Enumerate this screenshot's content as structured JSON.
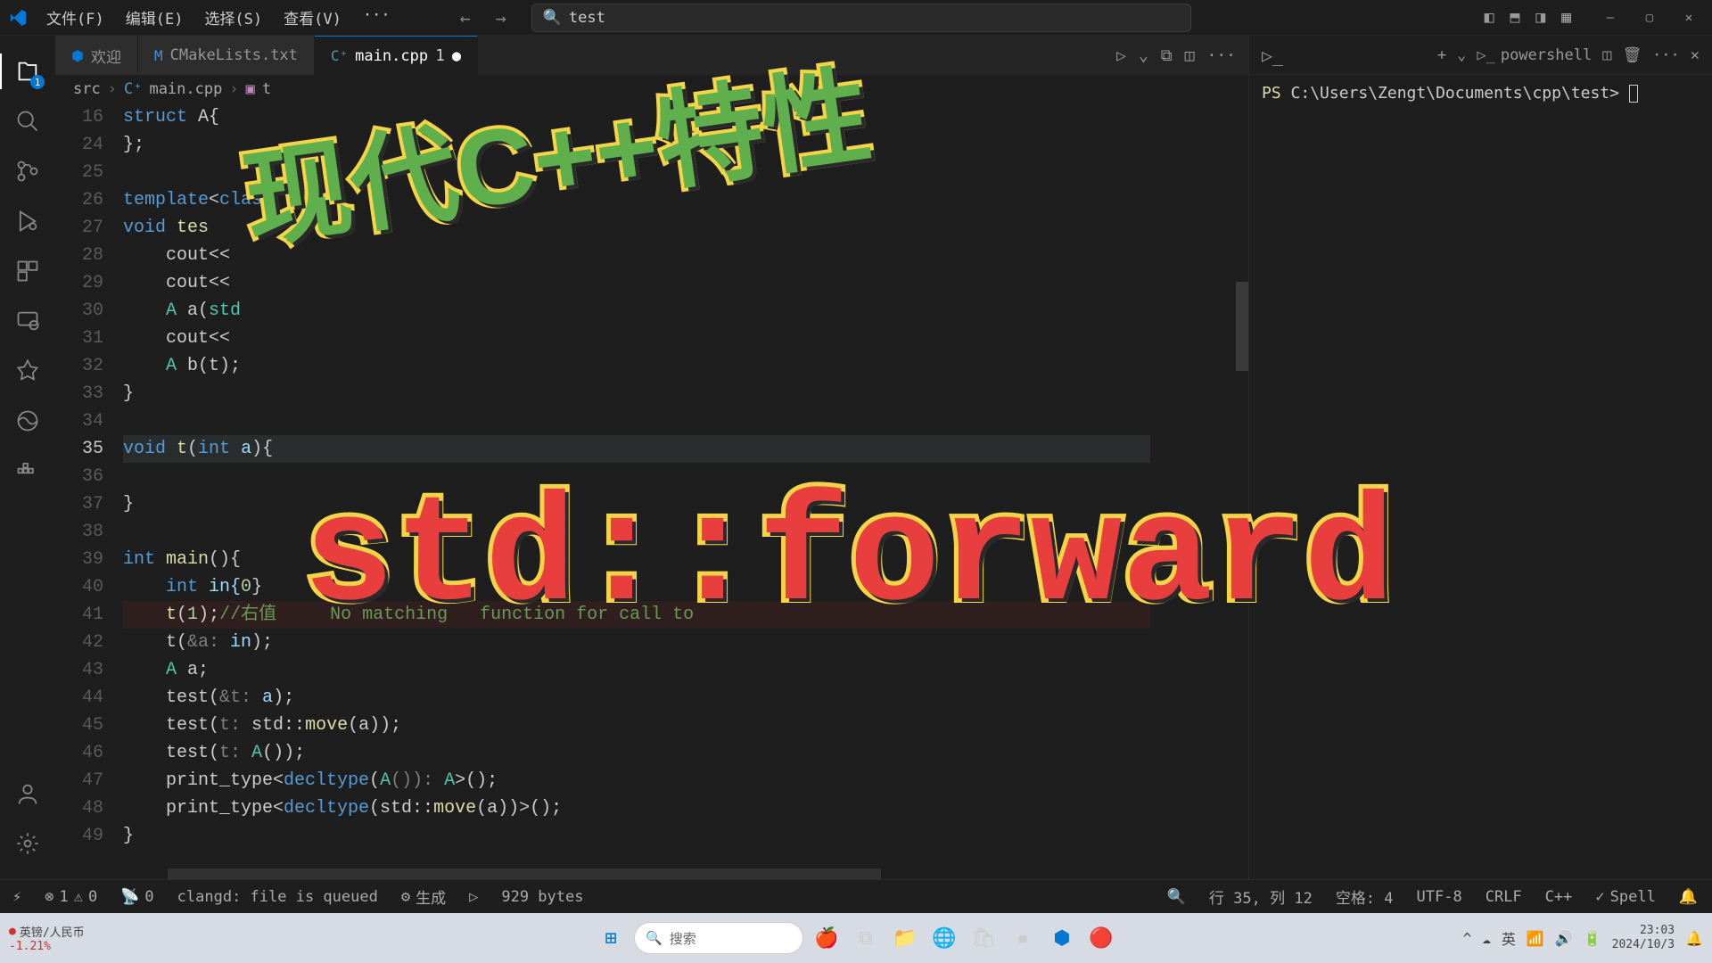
{
  "menu": {
    "file": "文件(F)",
    "edit": "编辑(E)",
    "select": "选择(S)",
    "view": "查看(V)",
    "dots": "···"
  },
  "search": {
    "placeholder": "test"
  },
  "tabs": {
    "welcome": {
      "label": "欢迎"
    },
    "cmake": {
      "label": "CMakeLists.txt"
    },
    "main": {
      "label": "main.cpp",
      "modified": "1"
    }
  },
  "breadcrumb": {
    "seg1": "src",
    "seg2": "main.cpp",
    "seg3": "t"
  },
  "activity_badge": "1",
  "lines": {
    "n16": "16",
    "n24": "24",
    "n25": "25",
    "n26": "26",
    "n27": "27",
    "n28": "28",
    "n29": "29",
    "n30": "30",
    "n31": "31",
    "n32": "32",
    "n33": "33",
    "n34": "34",
    "n35": "35",
    "n36": "36",
    "n37": "37",
    "n38": "38",
    "n39": "39",
    "n40": "40",
    "n41": "41",
    "n42": "42",
    "n43": "43",
    "n44": "44",
    "n45": "45",
    "n46": "46",
    "n47": "47",
    "n48": "48",
    "n49": "49"
  },
  "code": {
    "l16_a": "struct",
    "l16_b": " A{",
    "l24": "};",
    "l26_a": "template",
    "l26_b": "<",
    "l26_c": "clas",
    "l27_a": "void",
    "l27_b": " tes",
    "l28": "    cout<<",
    "l29": "    cout<<",
    "l30_a": "    ",
    "l30_b": "A",
    "l30_c": " a(",
    "l30_d": "std",
    "l31": "    cout<<",
    "l32_a": "    ",
    "l32_b": "A",
    "l32_c": " b(t);",
    "l33": "}",
    "l35_a": "void",
    "l35_b": " t",
    "l35_c": "(",
    "l35_d": "int",
    "l35_e": " a",
    "l35_f": ")",
    "l35_g": "{",
    "l37": "}",
    "l39_a": "int",
    "l39_b": " main",
    "l39_c": "(){",
    "l40_a": "    ",
    "l40_b": "int",
    "l40_c": " in{",
    "l40_d": "0",
    "l40_e": "}",
    "l41_a": "    ",
    "l41_b": "t",
    "l41_c": "(",
    "l41_d": "1",
    "l41_e": ");",
    "l41_f": "//右值     No matching   function for call to",
    "l42_a": "    t(",
    "l42_b": "&a:",
    "l42_c": " in",
    "l42_d": ");",
    "l43_a": "    ",
    "l43_b": "A",
    "l43_c": " a;",
    "l44_a": "    test(",
    "l44_b": "&t:",
    "l44_c": " a",
    "l44_d": ");",
    "l45_a": "    test(",
    "l45_b": "t:",
    "l45_c": " std::",
    "l45_d": "move",
    "l45_e": "(a));",
    "l46_a": "    test(",
    "l46_b": "t:",
    "l46_c": " A",
    "l46_d": "());",
    "l47_a": "    print_type<",
    "l47_b": "decltype",
    "l47_c": "(",
    "l47_d": "A",
    "l47_e": "()): ",
    "l47_f": "A",
    "l47_g": ">();",
    "l48_a": "    print_type<",
    "l48_b": "decltype",
    "l48_c": "(std::",
    "l48_d": "move",
    "l48_e": "(a))>();",
    "l49": "}"
  },
  "terminal": {
    "shell": "powershell",
    "prompt": "PS ",
    "path": "C:\\Users\\Zengt\\Documents\\cpp\\test>"
  },
  "status": {
    "errors": "1",
    "warnings": "0",
    "radio": "0",
    "clangd": "clangd: file is queued",
    "build": "生成",
    "bytes": "929 bytes",
    "cursor": "行 35, 列 12",
    "spaces": "空格: 4",
    "encoding": "UTF-8",
    "eol": "CRLF",
    "lang": "C++",
    "spell": "Spell"
  },
  "taskbar": {
    "label": "英镑/人民币",
    "change": "-1.21%",
    "search": "搜索",
    "ime": "英",
    "time": "23:03",
    "date": "2024/10/3"
  },
  "overlay": {
    "text1": "现代C++特性",
    "text2": "std::forward"
  }
}
